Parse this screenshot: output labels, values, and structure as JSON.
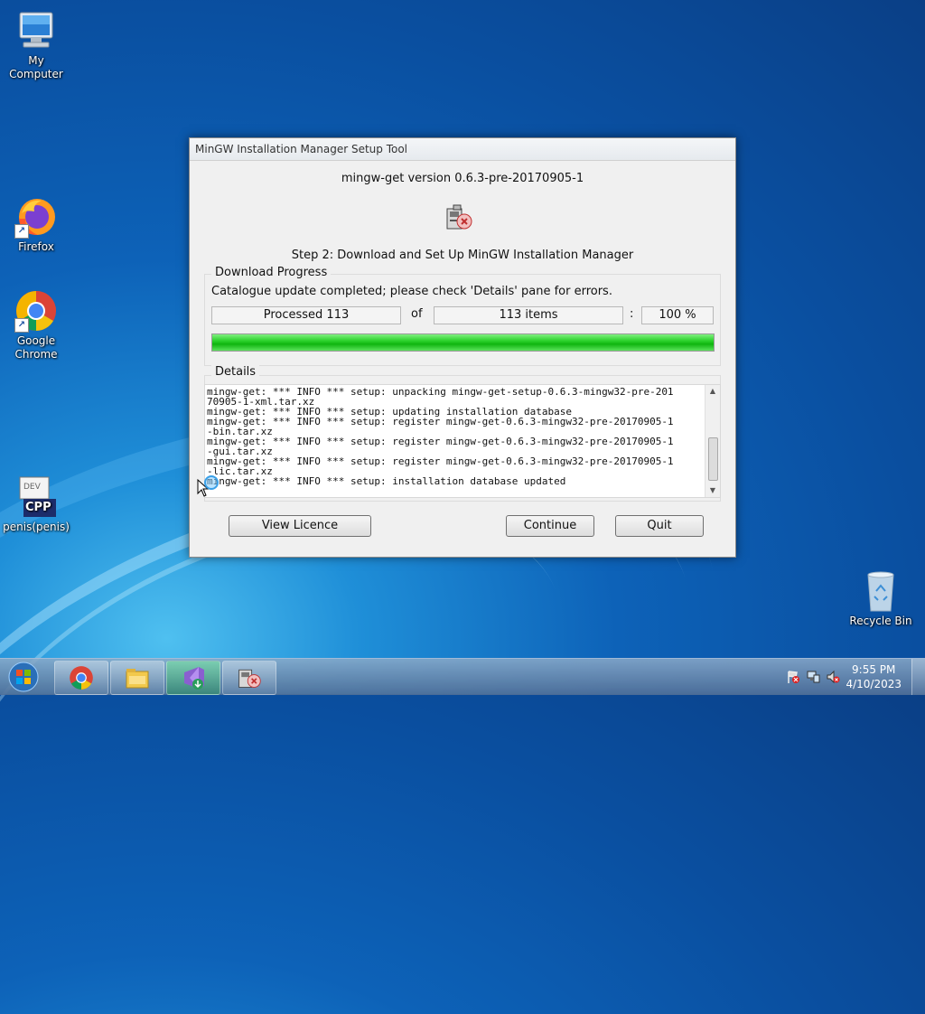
{
  "desktop": {
    "icons": [
      {
        "label": "My Computer"
      },
      {
        "label": "Firefox"
      },
      {
        "label": "Google Chrome"
      },
      {
        "label": "penis(penis)"
      },
      {
        "label": "Recycle Bin"
      }
    ],
    "cpp_icon_text": "CPP",
    "dev_icon_text": "DEV"
  },
  "dialog": {
    "title": "MinGW Installation Manager Setup Tool",
    "version": "mingw-get version 0.6.3-pre-20170905-1",
    "step": "Step 2: Download and Set Up MinGW Installation Manager",
    "download_group_label": "Download Progress",
    "status": "Catalogue update completed; please check 'Details' pane for errors.",
    "processed": "Processed 113",
    "of_label": "of",
    "items": "113 items",
    "colon": ":",
    "percent": "100 %",
    "progress_fraction": 1.0,
    "details_label": "Details",
    "log_lines": [
      "mingw-get: *** INFO *** setup: unpacking mingw-get-setup-0.6.3-mingw32-pre-201",
      "70905-1-xml.tar.xz",
      "mingw-get: *** INFO *** setup: updating installation database",
      "mingw-get: *** INFO *** setup: register mingw-get-0.6.3-mingw32-pre-20170905-1",
      "-bin.tar.xz",
      "mingw-get: *** INFO *** setup: register mingw-get-0.6.3-mingw32-pre-20170905-1",
      "-gui.tar.xz",
      "mingw-get: *** INFO *** setup: register mingw-get-0.6.3-mingw32-pre-20170905-1",
      "-lic.tar.xz",
      "mingw-get: *** INFO *** setup: installation database updated"
    ],
    "buttons": {
      "view_licence": "View Licence",
      "continue": "Continue",
      "quit": "Quit"
    }
  },
  "taskbar": {
    "items": [
      {
        "icon": "chrome-icon"
      },
      {
        "icon": "file-explorer-icon"
      },
      {
        "icon": "visual-studio-installer-icon"
      },
      {
        "icon": "mingw-setup-icon"
      }
    ],
    "clock": {
      "time": "9:55 PM",
      "date": "4/10/2023"
    }
  },
  "colors": {
    "progress_green": "#10b510",
    "desktop_blue": "#0d62b8"
  }
}
